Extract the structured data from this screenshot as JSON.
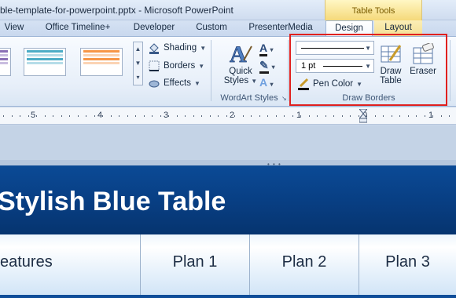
{
  "window": {
    "title": "ble-template-for-powerpoint.pptx - Microsoft PowerPoint",
    "context_group": "Table Tools"
  },
  "tabs": [
    {
      "label": "View"
    },
    {
      "label": "Office Timeline+"
    },
    {
      "label": "Developer"
    },
    {
      "label": "Custom"
    },
    {
      "label": "PresenterMedia"
    },
    {
      "label": "Design",
      "active": true
    },
    {
      "label": "Layout"
    }
  ],
  "ribbon": {
    "table_styles": {
      "shading_label": "Shading",
      "borders_label": "Borders",
      "effects_label": "Effects"
    },
    "wordart": {
      "quick_styles_line1": "Quick",
      "quick_styles_line2": "Styles",
      "group_label": "WordArt Styles"
    },
    "draw_borders": {
      "pen_weight": "1 pt",
      "pen_color_label": "Pen Color",
      "draw_table_line1": "Draw",
      "draw_table_line2": "Table",
      "eraser_label": "Eraser",
      "group_label": "Draw Borders"
    }
  },
  "ruler": {
    "numbers": [
      "5",
      "4",
      "3",
      "2",
      "1",
      "0",
      "1"
    ]
  },
  "slide": {
    "title": "Stylish Blue Table",
    "columns": [
      "eatures",
      "Plan 1",
      "Plan 2",
      "Plan 3"
    ]
  },
  "colors": {
    "banner": "#0b4a96",
    "highlight": "#e0201e",
    "context_tab": "#f5d97a"
  }
}
